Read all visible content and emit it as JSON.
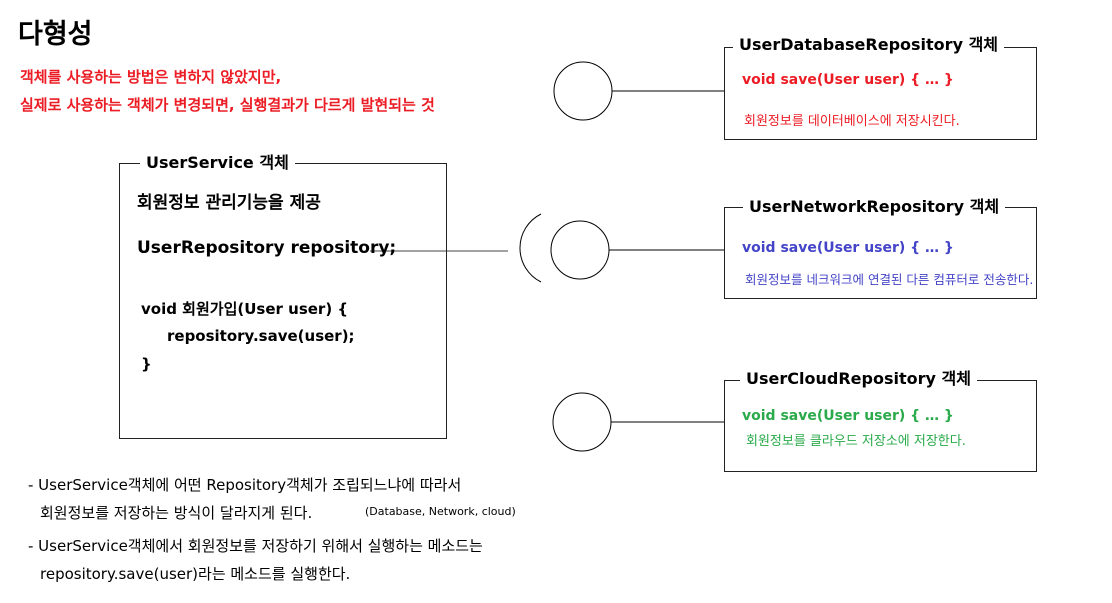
{
  "title": "다형성",
  "subtitle_lines": [
    "객체를 사용하는 방법은 변하지 않았지만,",
    "실제로 사용하는 객체가 변경되면, 실행결과가 다르게 발현되는 것"
  ],
  "user_service": {
    "legend": "UserService 객체",
    "heading": "회원정보 관리기능을 제공",
    "field": "UserRepository repository;",
    "method_sig": "void 회원가입(User user) {",
    "method_body": "repository.save(user);",
    "method_close": "}"
  },
  "repositories": [
    {
      "legend": "UserDatabaseRepository  객체",
      "method": "void save(User user) { … }",
      "description": "회원정보를 데이터베이스에 저장시킨다.",
      "method_color": "#ec1c24",
      "desc_color": "#ec1c24"
    },
    {
      "legend": "UserNetworkRepository 객체",
      "method": "void save(User user) { … }",
      "description": "회원정보를 네크워크에 연결된 다른 컴퓨터로 전송한다.",
      "method_color": "#4444c8",
      "desc_color": "#4444c8"
    },
    {
      "legend": "UserCloudRepository  객체",
      "method": "void save(User user) { … }",
      "description": "회원정보를 클라우드 저장소에 저장한다.",
      "method_color": "#2aaa4a",
      "desc_color": "#2aaa4a"
    }
  ],
  "notes": [
    {
      "line1": "- UserService객체에 어떤 Repository객체가 조립되느냐에 따라서",
      "line2": "회원정보를 저장하는 방식이 달라지게 된다.",
      "line2_small": "(Database, Network, cloud)"
    },
    {
      "line1": "- UserService객체에서 회원정보를 저장하기 위해서 실행하는 메소드는",
      "line2": "repository.save(user)라는 메소드를 실행한다.",
      "line2_small": ""
    }
  ]
}
